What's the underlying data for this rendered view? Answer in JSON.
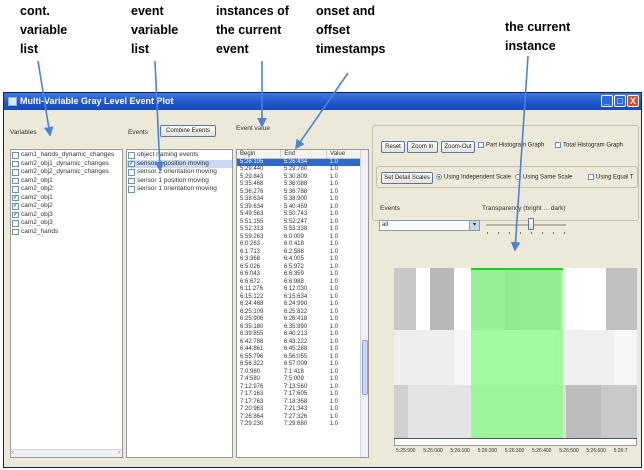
{
  "annotations": {
    "cont_var_list": [
      "cont.",
      "variable",
      "list"
    ],
    "event_var_list": [
      "event",
      "variable",
      "list"
    ],
    "instances": [
      "instances of",
      "the current",
      "event"
    ],
    "timestamps": [
      "onset and",
      "offset",
      "timestamps"
    ],
    "current_instance": [
      "the current",
      "instance"
    ]
  },
  "window": {
    "title": "Multi-Variable Gray Level Event Plot",
    "controls": [
      "_",
      "□",
      "X"
    ]
  },
  "variables_panel": {
    "label": "Variables",
    "items": [
      {
        "label": "cam1_hands_dynamic_changes",
        "checked": false
      },
      {
        "label": "cam2_obj1_dynamic_changes",
        "checked": false
      },
      {
        "label": "cam2_obj2_dynamic_changes",
        "checked": false
      },
      {
        "label": "cam2_obj1",
        "checked": false
      },
      {
        "label": "cam2_obj2",
        "checked": false
      },
      {
        "label": "cam2_obj1",
        "checked": true
      },
      {
        "label": "cam2_obj2",
        "checked": true
      },
      {
        "label": "cam2_obj3",
        "checked": true
      },
      {
        "label": "cam2_obj3",
        "checked": false
      },
      {
        "label": "cam2_hands",
        "checked": false
      }
    ]
  },
  "events_panel": {
    "label": "Events",
    "combine_button": "Combine Events",
    "items": [
      {
        "label": "object naming events",
        "checked": false,
        "selected": false
      },
      {
        "label": "sensor 2 position moving",
        "checked": true,
        "selected": true
      },
      {
        "label": "sensor 2 orientation moving",
        "checked": false,
        "selected": false
      },
      {
        "label": "sensor 1 position moving",
        "checked": false,
        "selected": false
      },
      {
        "label": "sensor 1 orientation moving",
        "checked": false,
        "selected": false
      }
    ]
  },
  "event_value_panel": {
    "label": "Event value",
    "columns": [
      "Begin",
      "End",
      "Value"
    ],
    "rows": [
      [
        "5:26:105",
        "5:26:434",
        "1.0"
      ],
      [
        "5:29:440",
        "5:29:780",
        "1.0"
      ],
      [
        "5:29:843",
        "5:30:809",
        "1.0"
      ],
      [
        "5:35:468",
        "5:36:088",
        "1.0"
      ],
      [
        "5:36:276",
        "5:36:788",
        "1.0"
      ],
      [
        "5:38:634",
        "5:38:900",
        "1.0"
      ],
      [
        "5:39:634",
        "5:40:459",
        "1.0"
      ],
      [
        "5:49:563",
        "5:50:743",
        "1.0"
      ],
      [
        "5:51:155",
        "5:52:247",
        "1.0"
      ],
      [
        "5:52:313",
        "5:53:338",
        "1.0"
      ],
      [
        "5:59:263",
        "6:0:009",
        "1.0"
      ],
      [
        "6:0:263",
        "6:0:418",
        "1.0"
      ],
      [
        "6:1:713",
        "6:2:588",
        "1.0"
      ],
      [
        "6:3:368",
        "6:4:005",
        "1.0"
      ],
      [
        "6:5:026",
        "6:5:972",
        "1.0"
      ],
      [
        "6:6:043",
        "6:6:359",
        "1.0"
      ],
      [
        "6:6:672",
        "6:6:988",
        "1.0"
      ],
      [
        "6:11:276",
        "6:12:030",
        "1.0"
      ],
      [
        "6:15:122",
        "6:15:634",
        "1.0"
      ],
      [
        "6:24:468",
        "6:24:990",
        "1.0"
      ],
      [
        "6:25:109",
        "6:25:822",
        "1.0"
      ],
      [
        "6:25:906",
        "6:26:418",
        "1.0"
      ],
      [
        "6:35:180",
        "6:35:890",
        "1.0"
      ],
      [
        "6:39:855",
        "6:40:213",
        "1.0"
      ],
      [
        "6:42:788",
        "6:43:222",
        "1.0"
      ],
      [
        "6:44:861",
        "6:45:288",
        "1.0"
      ],
      [
        "6:55:796",
        "6:56:055",
        "1.0"
      ],
      [
        "6:56:322",
        "6:57:009",
        "1.0"
      ],
      [
        "7:0:980",
        "7:1:418",
        "1.0"
      ],
      [
        "7:4:580",
        "7:5:009",
        "1.0"
      ],
      [
        "7:12:976",
        "7:13:560",
        "1.0"
      ],
      [
        "7:17:163",
        "7:17:605",
        "1.0"
      ],
      [
        "7:17:763",
        "7:18:368",
        "1.0"
      ],
      [
        "7:20:963",
        "7:21:343",
        "1.0"
      ],
      [
        "7:26:864",
        "7:27:326",
        "1.0"
      ],
      [
        "7:29:230",
        "7:29:680",
        "1.0"
      ]
    ]
  },
  "controls": {
    "reset": "Reset",
    "zoom_in": "Zoom In",
    "zoom_out": "Zoom-Out",
    "part_histogram": "Part Histogram Graph",
    "total_histogram": "Total Histogram Graph",
    "set_detail_scales": "Set Detail Scales",
    "independent_scale": "Using Independent Scale",
    "same_scale": "Using Same Scale",
    "using_equal": "Using Equal T",
    "events_label": "Events",
    "events_select_value": "all",
    "transparency_label": "Transparency (bright ... dark)"
  },
  "plot": {
    "x_ticks": [
      "5:25:900",
      "5:26:000",
      "5:26:100",
      "5:26:200",
      "5:26:300",
      "5:26:400",
      "5:26:500",
      "5:26:600",
      "5:26:7"
    ],
    "highlight_color": "#7dff7d",
    "highlight_edge_color": "#22cc22"
  }
}
